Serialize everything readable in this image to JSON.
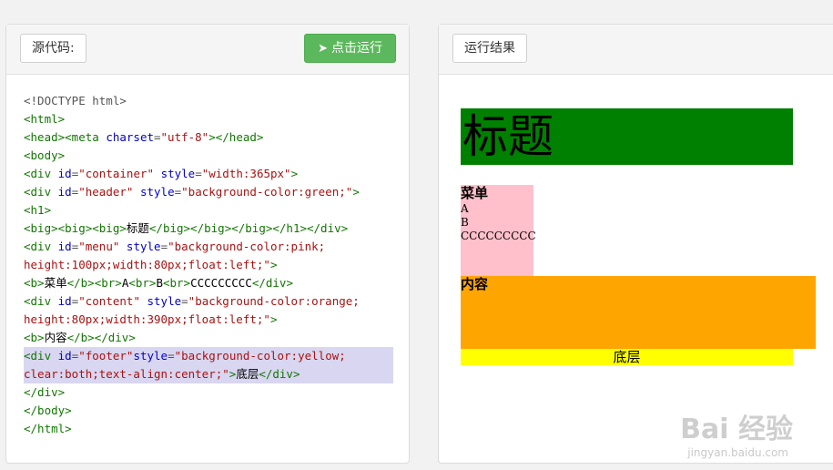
{
  "left_panel": {
    "source_button_label": "源代码:",
    "run_button_label": "点击运行",
    "run_icon": "send-icon",
    "code_lines": [
      [
        {
          "c": "tx",
          "t": "<!DOCTYPE html>"
        }
      ],
      [
        {
          "c": "tg",
          "t": "<html>"
        }
      ],
      [
        {
          "c": "tg",
          "t": "<head><meta "
        },
        {
          "c": "at",
          "t": "charset"
        },
        {
          "c": "tx",
          "t": "="
        },
        {
          "c": "st",
          "t": "\"utf-8\""
        },
        {
          "c": "tg",
          "t": "></head>"
        }
      ],
      [
        {
          "c": "tg",
          "t": "<body>"
        }
      ],
      [
        {
          "c": "tg",
          "t": "<div "
        },
        {
          "c": "at",
          "t": "id"
        },
        {
          "c": "tx",
          "t": "="
        },
        {
          "c": "st",
          "t": "\"container\""
        },
        {
          "c": "tx",
          "t": " "
        },
        {
          "c": "at",
          "t": "style"
        },
        {
          "c": "tx",
          "t": "="
        },
        {
          "c": "st",
          "t": "\"width:365px\""
        },
        {
          "c": "tg",
          "t": ">"
        }
      ],
      [
        {
          "c": "tg",
          "t": "<div "
        },
        {
          "c": "at",
          "t": "id"
        },
        {
          "c": "tx",
          "t": "="
        },
        {
          "c": "st",
          "t": "\"header\""
        },
        {
          "c": "tx",
          "t": " "
        },
        {
          "c": "at",
          "t": "style"
        },
        {
          "c": "tx",
          "t": "="
        },
        {
          "c": "st",
          "t": "\"background-color:green;\""
        },
        {
          "c": "tg",
          "t": ">"
        }
      ],
      [
        {
          "c": "tg",
          "t": "<h1>"
        }
      ],
      [
        {
          "c": "tg",
          "t": "<big><big><big>"
        },
        {
          "c": "ch",
          "t": "标题"
        },
        {
          "c": "tg",
          "t": "</big></big></big></h1></div>"
        }
      ],
      [
        {
          "c": "tg",
          "t": "<div "
        },
        {
          "c": "at",
          "t": "id"
        },
        {
          "c": "tx",
          "t": "="
        },
        {
          "c": "st",
          "t": "\"menu\""
        },
        {
          "c": "tx",
          "t": " "
        },
        {
          "c": "at",
          "t": "style"
        },
        {
          "c": "tx",
          "t": "="
        },
        {
          "c": "st",
          "t": "\"background-color:pink;"
        }
      ],
      [
        {
          "c": "st",
          "t": "height:100px;width:80px;float:left;\""
        },
        {
          "c": "tg",
          "t": ">"
        }
      ],
      [
        {
          "c": "tg",
          "t": "<b>"
        },
        {
          "c": "ch",
          "t": "菜单"
        },
        {
          "c": "tg",
          "t": "</b><br>"
        },
        {
          "c": "ch",
          "t": "A"
        },
        {
          "c": "tg",
          "t": "<br>"
        },
        {
          "c": "ch",
          "t": "B"
        },
        {
          "c": "tg",
          "t": "<br>"
        },
        {
          "c": "ch",
          "t": "CCCCCCCCC"
        },
        {
          "c": "tg",
          "t": "</div>"
        }
      ],
      [
        {
          "c": "tg",
          "t": "<div "
        },
        {
          "c": "at",
          "t": "id"
        },
        {
          "c": "tx",
          "t": "="
        },
        {
          "c": "st",
          "t": "\"content\""
        },
        {
          "c": "tx",
          "t": " "
        },
        {
          "c": "at",
          "t": "style"
        },
        {
          "c": "tx",
          "t": "="
        },
        {
          "c": "st",
          "t": "\"background-color:orange;"
        }
      ],
      [
        {
          "c": "st",
          "t": "height:80px;width:390px;float:left;\""
        },
        {
          "c": "tg",
          "t": ">"
        }
      ],
      [
        {
          "c": "tg",
          "t": "<b>"
        },
        {
          "c": "ch",
          "t": "内容"
        },
        {
          "c": "tg",
          "t": "</b></div>"
        }
      ],
      [
        {
          "c": "tg",
          "t": "<div "
        },
        {
          "c": "at",
          "t": "id"
        },
        {
          "c": "tx",
          "t": "="
        },
        {
          "c": "st",
          "t": "\"footer\""
        },
        {
          "c": "at",
          "t": "style"
        },
        {
          "c": "tx",
          "t": "="
        },
        {
          "c": "st",
          "t": "\"background-color:yellow;"
        }
      ],
      [
        {
          "c": "st",
          "t": "clear:both;text-align:center;\""
        },
        {
          "c": "tg",
          "t": ">"
        },
        {
          "c": "ch",
          "t": "底层"
        },
        {
          "c": "tg",
          "t": "</div>"
        }
      ],
      [
        {
          "c": "tg",
          "t": "</div>"
        }
      ],
      [
        {
          "c": "tg",
          "t": "</body>"
        }
      ],
      [
        {
          "c": "tg",
          "t": "</html>"
        }
      ]
    ],
    "highlighted_lines": [
      14,
      15
    ]
  },
  "right_panel": {
    "result_button_label": "运行结果",
    "header_title": "标题",
    "menu_title": "菜单",
    "menu_items": [
      "A",
      "B",
      "CCCCCCCCC"
    ],
    "content_title": "内容",
    "footer_text": "底层"
  },
  "watermark": {
    "brand": "Bai 经验",
    "url": "jingyan.baidu.com"
  }
}
